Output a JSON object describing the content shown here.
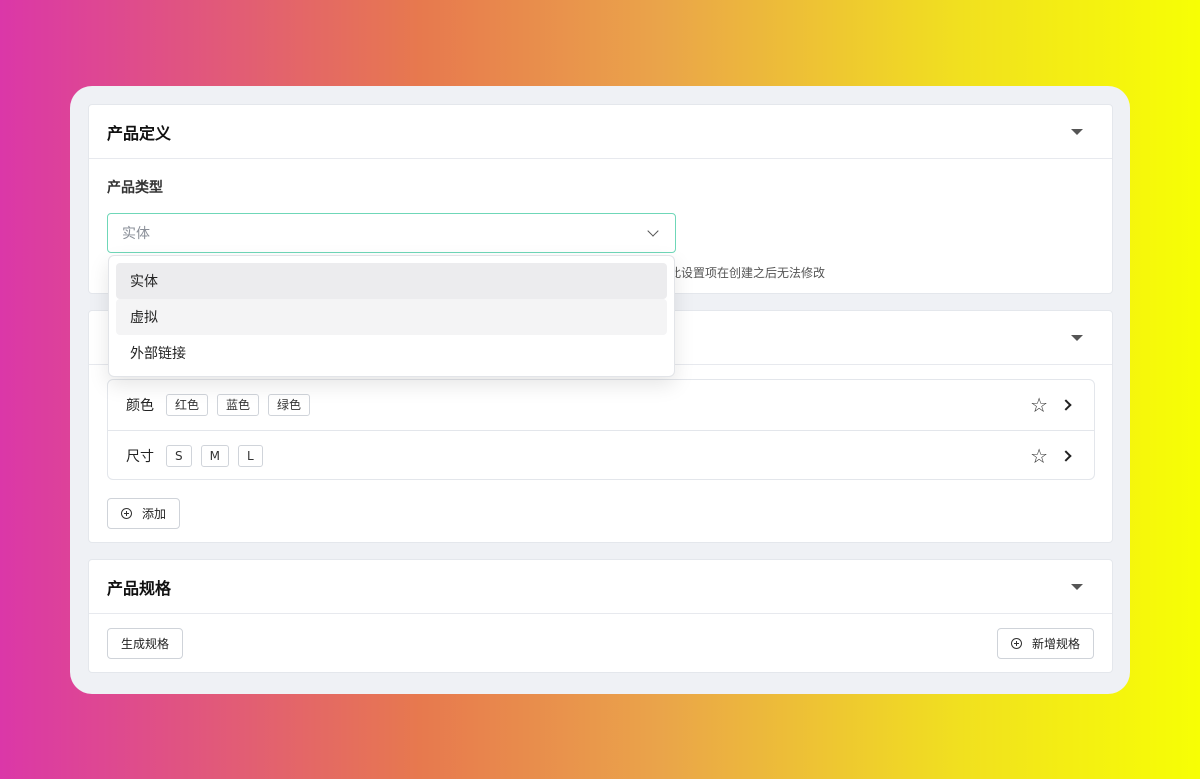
{
  "product_definition": {
    "title": "产品定义",
    "type_label": "产品类型",
    "select_value": "实体",
    "hint": "此设置项在创建之后无法修改",
    "options": [
      "实体",
      "虚拟",
      "外部链接"
    ]
  },
  "attributes": {
    "rows": [
      {
        "label": "颜色",
        "tags": [
          "红色",
          "蓝色",
          "绿色"
        ]
      },
      {
        "label": "尺寸",
        "tags": [
          "S",
          "M",
          "L"
        ]
      }
    ],
    "add_label": "添加"
  },
  "specs": {
    "title": "产品规格",
    "generate_label": "生成规格",
    "new_label": "新增规格"
  },
  "colors": {
    "select_border": "#6fd7b8",
    "panel_bg": "#eff1f5"
  }
}
